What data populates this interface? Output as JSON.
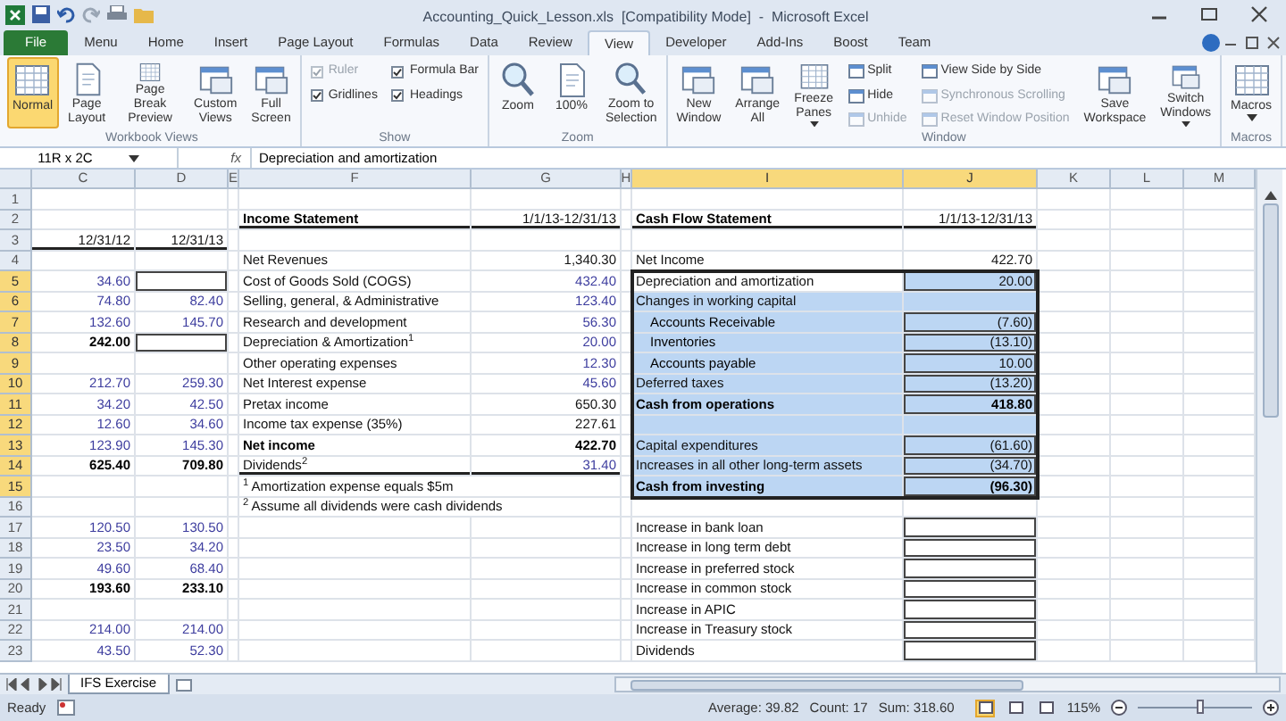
{
  "window": {
    "title": "Accounting_Quick_Lesson.xls  [Compatibility Mode]  -  Microsoft Excel"
  },
  "ribbon_tabs": [
    {
      "label": "File",
      "kind": "file",
      "selected": false
    },
    {
      "label": "Menu",
      "kind": "tab",
      "selected": false
    },
    {
      "label": "Home",
      "kind": "tab",
      "selected": false
    },
    {
      "label": "Insert",
      "kind": "tab",
      "selected": false
    },
    {
      "label": "Page Layout",
      "kind": "tab",
      "selected": false
    },
    {
      "label": "Formulas",
      "kind": "tab",
      "selected": false
    },
    {
      "label": "Data",
      "kind": "tab",
      "selected": false
    },
    {
      "label": "Review",
      "kind": "tab",
      "selected": false
    },
    {
      "label": "View",
      "kind": "tab",
      "selected": true
    },
    {
      "label": "Developer",
      "kind": "tab",
      "selected": false
    },
    {
      "label": "Add-Ins",
      "kind": "tab",
      "selected": false
    },
    {
      "label": "Boost",
      "kind": "tab",
      "selected": false
    },
    {
      "label": "Team",
      "kind": "tab",
      "selected": false
    }
  ],
  "ribbon_groups": [
    {
      "label": "Workbook Views",
      "items": [
        {
          "kind": "large",
          "label": "Normal",
          "selected": true
        },
        {
          "kind": "large",
          "label": "Page Layout",
          "selected": false
        },
        {
          "kind": "large",
          "label": "Page Break Preview",
          "selected": false
        },
        {
          "kind": "large",
          "label": "Custom Views",
          "selected": false
        },
        {
          "kind": "large",
          "label": "Full Screen",
          "selected": false
        }
      ]
    },
    {
      "label": "Show",
      "items": [
        {
          "kind": "stack",
          "items": [
            {
              "kind": "check",
              "label": "Ruler",
              "checked": true,
              "disabled": true
            },
            {
              "kind": "check",
              "label": "Gridlines",
              "checked": true,
              "disabled": false
            }
          ]
        },
        {
          "kind": "stack",
          "items": [
            {
              "kind": "check",
              "label": "Formula Bar",
              "checked": true,
              "disabled": false
            },
            {
              "kind": "check",
              "label": "Headings",
              "checked": true,
              "disabled": false
            }
          ]
        }
      ]
    },
    {
      "label": "Zoom",
      "items": [
        {
          "kind": "large",
          "label": "Zoom",
          "selected": false
        },
        {
          "kind": "large",
          "label": "100%",
          "selected": false
        },
        {
          "kind": "large",
          "label": "Zoom to Selection",
          "selected": false
        }
      ]
    },
    {
      "label": "Window",
      "items": [
        {
          "kind": "large",
          "label": "New Window",
          "selected": false
        },
        {
          "kind": "large",
          "label": "Arrange All",
          "selected": false
        },
        {
          "kind": "large",
          "label": "Freeze Panes",
          "selected": false,
          "dropdown": true
        },
        {
          "kind": "stack",
          "items": [
            {
              "kind": "small",
              "label": "Split",
              "disabled": false
            },
            {
              "kind": "small",
              "label": "Hide",
              "disabled": false
            },
            {
              "kind": "small",
              "label": "Unhide",
              "disabled": true
            }
          ]
        },
        {
          "kind": "stack",
          "items": [
            {
              "kind": "small",
              "label": "View Side by Side",
              "disabled": false
            },
            {
              "kind": "small",
              "label": "Synchronous Scrolling",
              "disabled": true
            },
            {
              "kind": "small",
              "label": "Reset Window Position",
              "disabled": true
            }
          ]
        },
        {
          "kind": "large",
          "label": "Save Workspace",
          "selected": false
        },
        {
          "kind": "large",
          "label": "Switch Windows",
          "selected": false,
          "dropdown": true
        }
      ]
    },
    {
      "label": "Macros",
      "items": [
        {
          "kind": "large",
          "label": "Macros",
          "selected": false,
          "dropdown": true
        }
      ]
    }
  ],
  "formula_bar": {
    "name_box": "11R x 2C",
    "fx": "fx",
    "value": "Depreciation and amortization"
  },
  "columns": [
    {
      "letter": "C",
      "selected": false
    },
    {
      "letter": "D",
      "selected": false
    },
    {
      "letter": "E",
      "selected": false
    },
    {
      "letter": "F",
      "selected": false
    },
    {
      "letter": "G",
      "selected": false
    },
    {
      "letter": "H",
      "selected": false
    },
    {
      "letter": "I",
      "selected": true
    },
    {
      "letter": "J",
      "selected": true
    },
    {
      "letter": "K",
      "selected": false
    },
    {
      "letter": "L",
      "selected": false
    },
    {
      "letter": "M",
      "selected": false
    }
  ],
  "rows": [
    {
      "number": "1",
      "selected": false,
      "cells": {}
    },
    {
      "number": "2",
      "selected": false,
      "cells": {
        "F": {
          "text": "Income Statement",
          "kind": "bold",
          "rule": true
        },
        "G": {
          "text": "1/1/13-12/31/13",
          "kind": "plain",
          "rule": true
        },
        "I": {
          "text": "Cash Flow Statement",
          "kind": "bold",
          "rule": true
        },
        "J": {
          "text": "1/1/13-12/31/13",
          "kind": "plain",
          "rule": true
        }
      }
    },
    {
      "number": "3",
      "selected": false,
      "cells": {
        "C": {
          "text": "12/31/12",
          "kind": "plain",
          "rule": true
        },
        "D": {
          "text": "12/31/13",
          "kind": "plain",
          "rule": true
        }
      }
    },
    {
      "number": "4",
      "selected": false,
      "cells": {
        "F": {
          "text": "Net Revenues",
          "kind": "plain"
        },
        "G": {
          "text": "1,340.30",
          "kind": "plain"
        },
        "I": {
          "text": "Net Income",
          "kind": "plain"
        },
        "J": {
          "text": "422.70",
          "kind": "plain"
        }
      }
    },
    {
      "number": "5",
      "selected": true,
      "cells": {
        "C": {
          "text": "34.60",
          "kind": "input"
        },
        "D": {
          "boxed": true
        },
        "F": {
          "text": "Cost of Goods Sold (COGS)",
          "kind": "plain"
        },
        "G": {
          "text": "432.40",
          "kind": "input"
        },
        "I": {
          "text": "Depreciation and amortization",
          "kind": "plain",
          "selected": false
        },
        "J": {
          "text": "20.00",
          "kind": "plain",
          "selected": true,
          "boxed": true
        }
      }
    },
    {
      "number": "6",
      "selected": true,
      "cells": {
        "C": {
          "text": "74.80",
          "kind": "input"
        },
        "D": {
          "text": "82.40",
          "kind": "input"
        },
        "F": {
          "text": "Selling, general, & Administrative",
          "kind": "plain"
        },
        "G": {
          "text": "123.40",
          "kind": "input"
        },
        "I": {
          "text": "Changes in working capital",
          "kind": "plain",
          "selected": true
        },
        "J": {
          "selected": true
        }
      }
    },
    {
      "number": "7",
      "selected": true,
      "cells": {
        "C": {
          "text": "132.60",
          "kind": "input"
        },
        "D": {
          "text": "145.70",
          "kind": "input"
        },
        "F": {
          "text": "Research and development",
          "kind": "plain"
        },
        "G": {
          "text": "56.30",
          "kind": "input"
        },
        "I": {
          "text": "Accounts Receivable",
          "kind": "indented",
          "selected": true
        },
        "J": {
          "text": "(7.60)",
          "kind": "plain",
          "selected": true,
          "boxed": true
        }
      }
    },
    {
      "number": "8",
      "selected": true,
      "cells": {
        "C": {
          "text": "242.00",
          "kind": "bold"
        },
        "D": {
          "boxed": true
        },
        "F": {
          "text": "Depreciation & Amortization$^{1}$",
          "kind": "plain"
        },
        "G": {
          "text": "20.00",
          "kind": "input"
        },
        "I": {
          "text": "Inventories",
          "kind": "indented",
          "selected": true
        },
        "J": {
          "text": "(13.10)",
          "kind": "plain",
          "selected": true,
          "boxed": true
        }
      }
    },
    {
      "number": "9",
      "selected": true,
      "cells": {
        "F": {
          "text": "Other operating expenses",
          "kind": "plain"
        },
        "G": {
          "text": "12.30",
          "kind": "input"
        },
        "I": {
          "text": "Accounts payable",
          "kind": "indented",
          "selected": true
        },
        "J": {
          "text": "10.00",
          "kind": "plain",
          "selected": true,
          "boxed": true
        }
      }
    },
    {
      "number": "10",
      "selected": true,
      "cells": {
        "C": {
          "text": "212.70",
          "kind": "input"
        },
        "D": {
          "text": "259.30",
          "kind": "input"
        },
        "F": {
          "text": "Net Interest expense",
          "kind": "plain"
        },
        "G": {
          "text": "45.60",
          "kind": "input"
        },
        "I": {
          "text": "Deferred taxes",
          "kind": "plain",
          "selected": true
        },
        "J": {
          "text": "(13.20)",
          "kind": "plain",
          "selected": true,
          "boxed": true
        }
      }
    },
    {
      "number": "11",
      "selected": true,
      "cells": {
        "C": {
          "text": "34.20",
          "kind": "input"
        },
        "D": {
          "text": "42.50",
          "kind": "input"
        },
        "F": {
          "text": "Pretax income",
          "kind": "plain"
        },
        "G": {
          "text": "650.30",
          "kind": "plain"
        },
        "I": {
          "text": "Cash from operations",
          "kind": "bold",
          "selected": true
        },
        "J": {
          "text": "418.80",
          "kind": "bold",
          "selected": true,
          "boxed": true
        }
      }
    },
    {
      "number": "12",
      "selected": true,
      "cells": {
        "C": {
          "text": "12.60",
          "kind": "input"
        },
        "D": {
          "text": "34.60",
          "kind": "input"
        },
        "F": {
          "text": "Income tax expense (35%)",
          "kind": "plain"
        },
        "G": {
          "text": "227.61",
          "kind": "plain"
        },
        "I": {
          "selected": true
        },
        "J": {
          "selected": true
        }
      }
    },
    {
      "number": "13",
      "selected": true,
      "cells": {
        "C": {
          "text": "123.90",
          "kind": "input"
        },
        "D": {
          "text": "145.30",
          "kind": "input"
        },
        "F": {
          "text": "Net income",
          "kind": "bold"
        },
        "G": {
          "text": "422.70",
          "kind": "bold"
        },
        "I": {
          "text": "Capital expenditures",
          "kind": "plain",
          "selected": true
        },
        "J": {
          "text": "(61.60)",
          "kind": "plain",
          "selected": true,
          "boxed": true
        }
      }
    },
    {
      "number": "14",
      "selected": true,
      "cells": {
        "C": {
          "text": "625.40",
          "kind": "bold"
        },
        "D": {
          "text": "709.80",
          "kind": "bold"
        },
        "F": {
          "text": "Dividends$^{2}$",
          "kind": "plain",
          "rule": true
        },
        "G": {
          "text": "31.40",
          "kind": "input",
          "rule": true
        },
        "I": {
          "text": "Increases in all other long-term assets",
          "kind": "plain",
          "selected": true
        },
        "J": {
          "text": "(34.70)",
          "kind": "plain",
          "selected": true,
          "boxed": true
        }
      }
    },
    {
      "number": "15",
      "selected": true,
      "cells": {
        "F": {
          "text": "$^{1}$ Amortization expense equals $5m",
          "kind": "note"
        },
        "I": {
          "text": "Cash from investing",
          "kind": "bold",
          "selected": true
        },
        "J": {
          "text": "(96.30)",
          "kind": "bold",
          "selected": true,
          "boxed": true
        }
      }
    },
    {
      "number": "16",
      "selected": false,
      "cells": {
        "F": {
          "text": "$^{2}$ Assume all dividends were cash dividends",
          "kind": "note"
        }
      }
    },
    {
      "number": "17",
      "selected": false,
      "cells": {
        "C": {
          "text": "120.50",
          "kind": "input"
        },
        "D": {
          "text": "130.50",
          "kind": "input"
        },
        "I": {
          "text": "Increase in bank loan",
          "kind": "plain"
        },
        "J": {
          "boxed": true
        }
      }
    },
    {
      "number": "18",
      "selected": false,
      "cells": {
        "C": {
          "text": "23.50",
          "kind": "input"
        },
        "D": {
          "text": "34.20",
          "kind": "input"
        },
        "I": {
          "text": "Increase in long term debt",
          "kind": "plain"
        },
        "J": {
          "boxed": true
        }
      }
    },
    {
      "number": "19",
      "selected": false,
      "cells": {
        "C": {
          "text": "49.60",
          "kind": "input"
        },
        "D": {
          "text": "68.40",
          "kind": "input"
        },
        "I": {
          "text": "Increase in preferred stock",
          "kind": "plain"
        },
        "J": {
          "boxed": true
        }
      }
    },
    {
      "number": "20",
      "selected": false,
      "cells": {
        "C": {
          "text": "193.60",
          "kind": "bold"
        },
        "D": {
          "text": "233.10",
          "kind": "bold"
        },
        "I": {
          "text": "Increase in common stock",
          "kind": "plain"
        },
        "J": {
          "boxed": true
        }
      }
    },
    {
      "number": "21",
      "selected": false,
      "cells": {
        "I": {
          "text": "Increase in APIC",
          "kind": "plain"
        },
        "J": {
          "boxed": true
        }
      }
    },
    {
      "number": "22",
      "selected": false,
      "cells": {
        "C": {
          "text": "214.00",
          "kind": "input"
        },
        "D": {
          "text": "214.00",
          "kind": "input"
        },
        "I": {
          "text": "Increase in Treasury stock",
          "kind": "plain"
        },
        "J": {
          "boxed": true
        }
      }
    },
    {
      "number": "23",
      "selected": false,
      "cells": {
        "C": {
          "text": "43.50",
          "kind": "input"
        },
        "D": {
          "text": "52.30",
          "kind": "input"
        },
        "I": {
          "text": "Dividends",
          "kind": "plain"
        },
        "J": {
          "boxed": true
        }
      }
    }
  ],
  "sheet_tabs": [
    {
      "label": "IFS Exercise",
      "selected": true
    }
  ],
  "status_bar": {
    "mode": "Ready",
    "average": "Average: 39.82",
    "count": "Count: 17",
    "sum": "Sum: 318.60",
    "views": [
      {
        "selected": true
      },
      {
        "selected": false
      },
      {
        "selected": false
      }
    ],
    "zoom": "115%",
    "zoom_slider": {
      "level": 0.55
    }
  }
}
